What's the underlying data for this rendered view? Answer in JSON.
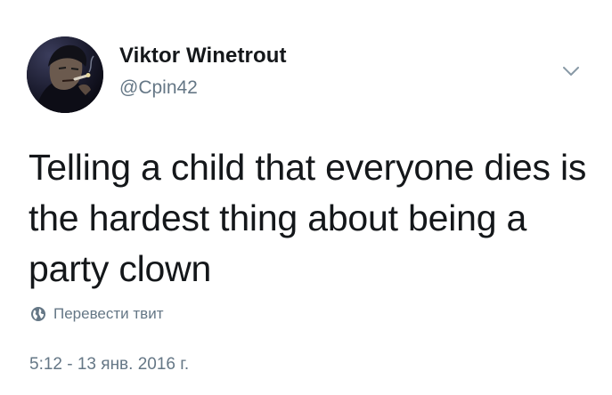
{
  "author": {
    "display_name": "Viktor Winetrout",
    "handle": "@Cpin42",
    "avatar_icon": "user-avatar"
  },
  "menu": {
    "caret_icon": "chevron-down-icon"
  },
  "tweet": {
    "text": "Telling a child that everyone dies is the hardest thing about being a party clown"
  },
  "translate": {
    "icon": "globe-icon",
    "label": "Перевести твит"
  },
  "timestamp": "5:12 - 13 янв. 2016 г.",
  "colors": {
    "primary_text": "#14171a",
    "secondary_text": "#657786",
    "background": "#ffffff"
  }
}
